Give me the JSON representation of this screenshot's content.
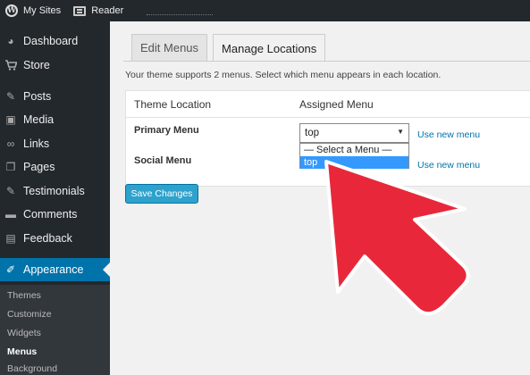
{
  "adminbar": {
    "logo_glyph": "W",
    "my_sites": "My Sites",
    "reader": "Reader"
  },
  "sidebar": {
    "items": [
      {
        "label": "Dashboard",
        "icon": "dashboard-icon",
        "glyph": "◕"
      },
      {
        "label": "Store",
        "icon": "cart-icon",
        "glyph": "🛒"
      },
      {
        "label": "Posts",
        "icon": "pushpin-icon",
        "glyph": "✎"
      },
      {
        "label": "Media",
        "icon": "media-icon",
        "glyph": "▣"
      },
      {
        "label": "Links",
        "icon": "link-icon",
        "glyph": "∞"
      },
      {
        "label": "Pages",
        "icon": "pages-icon",
        "glyph": "❐"
      },
      {
        "label": "Testimonials",
        "icon": "pushpin-icon",
        "glyph": "✎"
      },
      {
        "label": "Comments",
        "icon": "comment-icon",
        "glyph": "▬"
      },
      {
        "label": "Feedback",
        "icon": "feedback-icon",
        "glyph": "▤"
      },
      {
        "label": "Appearance",
        "icon": "brush-icon",
        "glyph": "✐"
      }
    ],
    "submenu": [
      "Themes",
      "Customize",
      "Widgets",
      "Menus",
      "Background"
    ],
    "active_color": "#0073aa"
  },
  "tabs": {
    "edit_menus": "Edit Menus",
    "manage_locations": "Manage Locations"
  },
  "intro_text": "Your theme supports 2 menus. Select which menu appears in each location.",
  "table": {
    "col_location": "Theme Location",
    "col_assigned": "Assigned Menu",
    "rows": [
      {
        "location": "Primary Menu",
        "selected": "top",
        "link": "Use new menu"
      },
      {
        "location": "Social Menu",
        "link": "Use new menu"
      }
    ]
  },
  "dropdown": {
    "options": [
      "— Select a Menu —",
      "top"
    ],
    "highlighted": "top",
    "caret": "▼"
  },
  "save_button": "Save Changes",
  "overlay": {
    "arrow_color": "#e8283a"
  }
}
